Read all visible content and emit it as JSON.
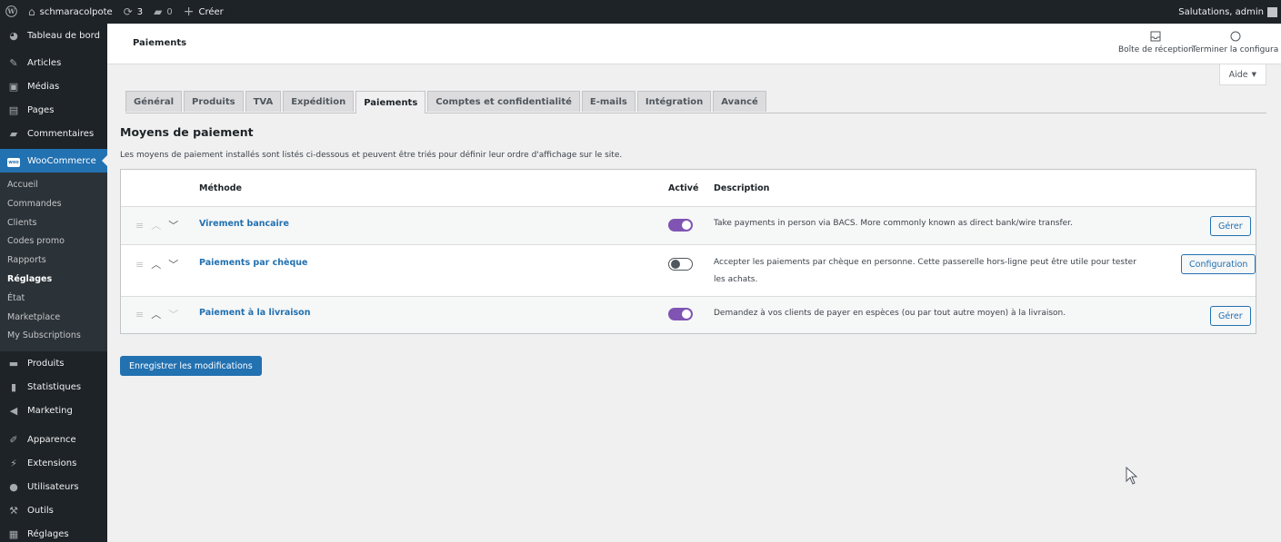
{
  "adminbar": {
    "site_name": "schmaracolpote",
    "updates_count": "3",
    "comments_count": "0",
    "new_label": "Créer",
    "greeting": "Salutations, admin"
  },
  "sidebar": {
    "items_top": [
      {
        "label": "Tableau de bord",
        "icon": "dashboard-icon"
      },
      {
        "label": "Articles",
        "icon": "pin-icon"
      },
      {
        "label": "Médias",
        "icon": "media-icon"
      },
      {
        "label": "Pages",
        "icon": "pages-icon"
      },
      {
        "label": "Commentaires",
        "icon": "comment-icon"
      }
    ],
    "woocommerce_label": "WooCommerce",
    "woo_logo_text": "woo",
    "submenu": [
      "Accueil",
      "Commandes",
      "Clients",
      "Codes promo",
      "Rapports",
      "Réglages",
      "État",
      "Marketplace",
      "My Subscriptions"
    ],
    "items_bottom": [
      {
        "label": "Produits",
        "icon": "products-icon"
      },
      {
        "label": "Statistiques",
        "icon": "stats-icon"
      },
      {
        "label": "Marketing",
        "icon": "megaphone-icon"
      },
      {
        "label": "Apparence",
        "icon": "brush-icon"
      },
      {
        "label": "Extensions",
        "icon": "plugin-icon"
      },
      {
        "label": "Utilisateurs",
        "icon": "users-icon"
      },
      {
        "label": "Outils",
        "icon": "wrench-icon"
      },
      {
        "label": "Réglages",
        "icon": "settings-icon"
      }
    ]
  },
  "header": {
    "title": "Paiements",
    "inbox_label": "Boîte de réception",
    "finish_setup_label": "Terminer la configura"
  },
  "help": {
    "label": "Aide"
  },
  "tabs": [
    "Général",
    "Produits",
    "TVA",
    "Expédition",
    "Paiements",
    "Comptes et confidentialité",
    "E-mails",
    "Intégration",
    "Avancé"
  ],
  "section": {
    "title": "Moyens de paiement",
    "description": "Les moyens de paiement installés sont listés ci-dessous et peuvent être triés pour définir leur ordre d'affichage sur le site."
  },
  "table": {
    "headers": {
      "method": "Méthode",
      "enabled": "Activé",
      "description": "Description"
    },
    "rows": [
      {
        "name": "Virement bancaire",
        "enabled": true,
        "description": "Take payments in person via BACS. More commonly known as direct bank/wire transfer.",
        "action": "Gérer"
      },
      {
        "name": "Paiements par chèque",
        "enabled": false,
        "description": "Accepter les paiements par chèque en personne. Cette passerelle hors-ligne peut être utile pour tester les achats.",
        "action": "Configuration"
      },
      {
        "name": "Paiement à la livraison",
        "enabled": true,
        "description": "Demandez à vos clients de payer en espèces (ou par tout autre moyen) à la livraison.",
        "action": "Gérer"
      }
    ]
  },
  "save_button": "Enregistrer les modifications",
  "colors": {
    "admin_dark": "#1d2327",
    "accent_blue": "#2271b1",
    "toggle_on": "#7f54b3"
  }
}
